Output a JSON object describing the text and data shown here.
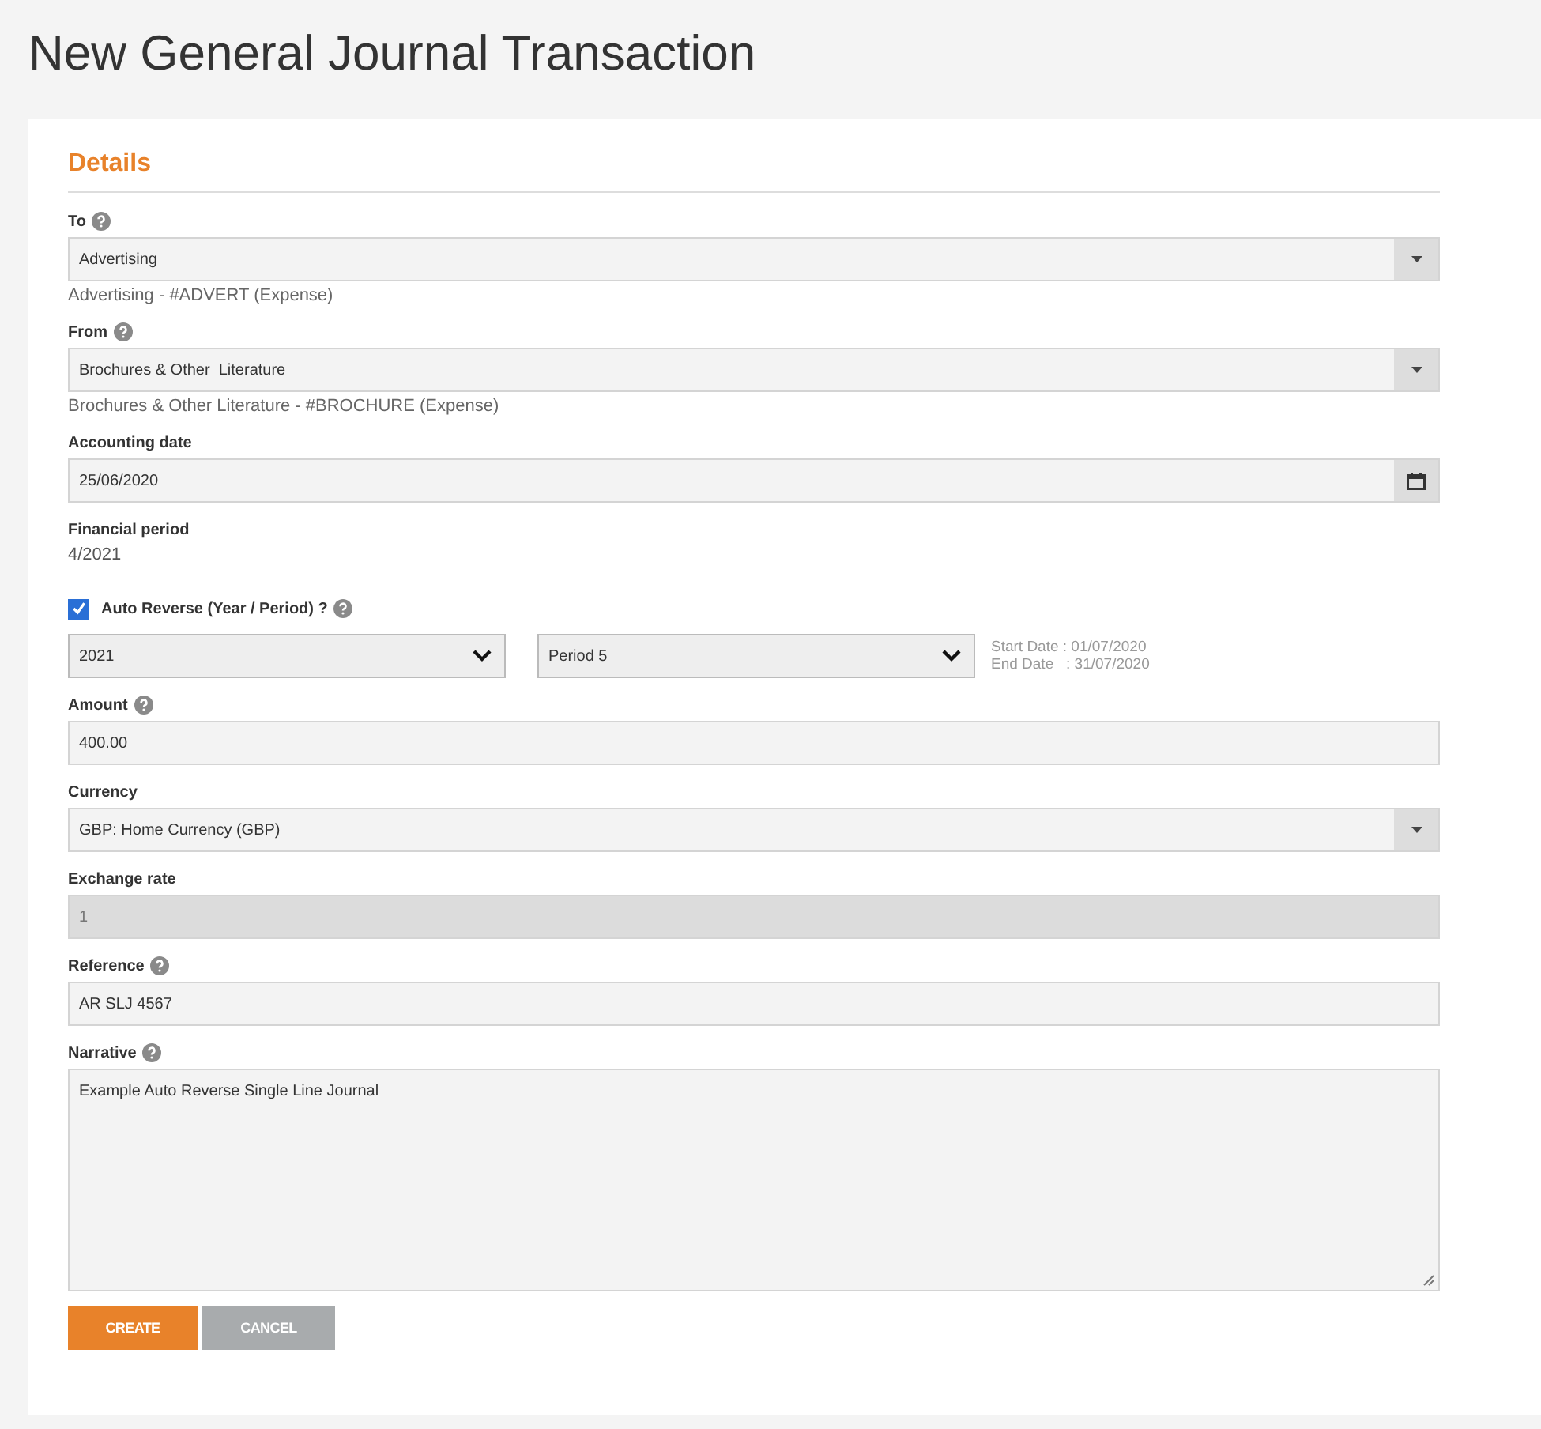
{
  "page": {
    "title": "New General Journal Transaction"
  },
  "section": {
    "title": "Details"
  },
  "fields": [
    {
      "kind": "select",
      "label": "To",
      "help": true,
      "value": "Advertising",
      "hint": "Advertising - #ADVERT (Expense)"
    },
    {
      "kind": "select",
      "label": "From",
      "help": true,
      "value": "Brochures & Other  Literature",
      "hint": "Brochures & Other Literature - #BROCHURE (Expense)"
    },
    {
      "kind": "date",
      "label": "Accounting date",
      "help": false,
      "value": "25/06/2020"
    },
    {
      "kind": "static",
      "label": "Financial period",
      "help": false,
      "value": "4/2021"
    },
    {
      "kind": "auto-reverse",
      "label": "Auto Reverse (Year / Period) ?",
      "help": true,
      "checked": true,
      "year": "2021",
      "period": "Period 5",
      "start_date": "Start Date : 01/07/2020",
      "end_date": "End Date   : 31/07/2020"
    },
    {
      "kind": "text",
      "label": "Amount",
      "help": true,
      "value": "400.00"
    },
    {
      "kind": "select",
      "label": "Currency",
      "help": false,
      "value": "GBP: Home Currency (GBP)"
    },
    {
      "kind": "readonly",
      "label": "Exchange rate",
      "help": false,
      "value": "1"
    },
    {
      "kind": "text",
      "label": "Reference",
      "help": true,
      "value": "AR SLJ 4567"
    },
    {
      "kind": "textarea",
      "label": "Narrative",
      "help": true,
      "value": "Example Auto Reverse Single Line Journal"
    }
  ],
  "buttons": [
    {
      "label": "CREATE",
      "kind": "primary"
    },
    {
      "label": "CANCEL",
      "kind": "secondary"
    }
  ]
}
